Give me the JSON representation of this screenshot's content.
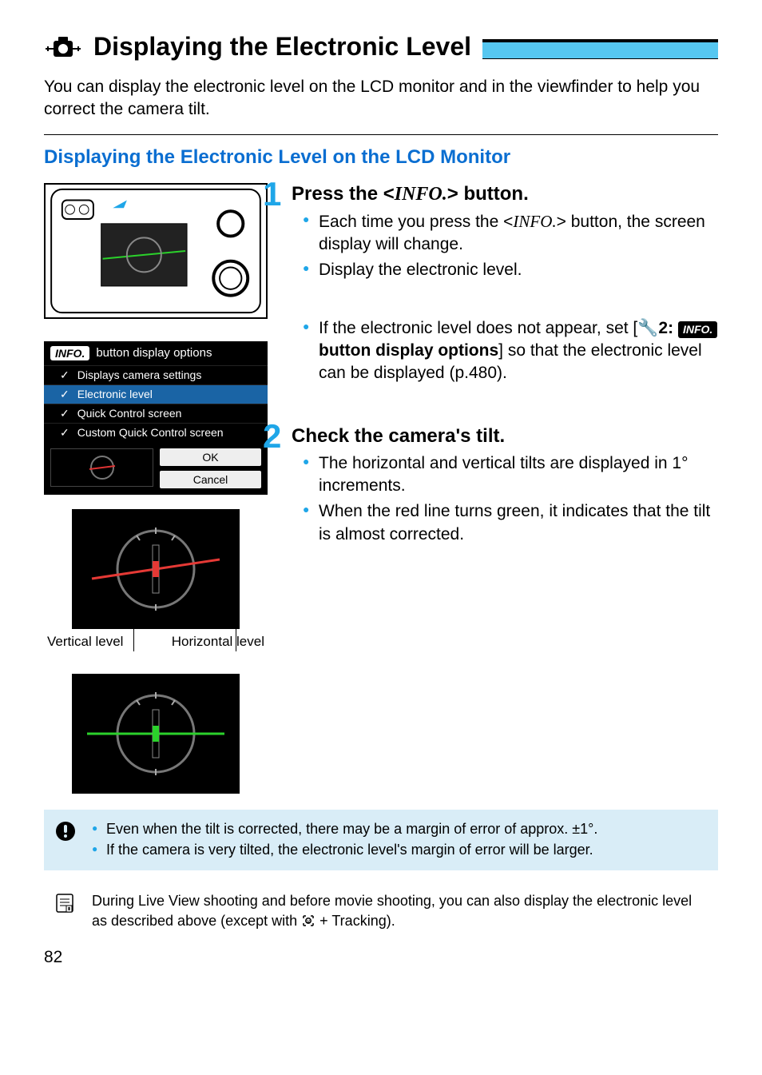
{
  "header": {
    "title": "Displaying the Electronic Level"
  },
  "intro": "You can display the electronic level on the LCD monitor and in the viewfinder to help you correct the camera tilt.",
  "section": {
    "title": "Displaying the Electronic Level on the LCD Monitor"
  },
  "menu": {
    "info_label": "INFO.",
    "head": "button display options",
    "items": [
      "Displays camera settings",
      "Electronic level",
      "Quick Control screen",
      "Custom Quick Control screen"
    ],
    "ok": "OK",
    "cancel": "Cancel"
  },
  "step1": {
    "num": "1",
    "title_pre": "Press the <",
    "title_info": "INFO.",
    "title_post": "> button.",
    "b1_pre": "Each time you press the <",
    "b1_info": "INFO.",
    "b1_post": "> button, the screen display will change.",
    "b2": "Display the electronic level.",
    "b3_pre": "If the electronic level does not appear, set [",
    "b3_wrench": "2:",
    "b3_info": "INFO.",
    "b3_bold": " button display options",
    "b3_post": "] so that the electronic level can be displayed (p.480)."
  },
  "step2": {
    "num": "2",
    "title": "Check the camera's tilt.",
    "b1": "The horizontal and vertical tilts are displayed in 1° increments.",
    "b2": "When the red line turns green, it indicates that the tilt is almost corrected."
  },
  "labels": {
    "vertical": "Vertical level",
    "horizontal": "Horizontal level"
  },
  "note1": {
    "b1": "Even when the tilt is corrected, there may be a margin of error of approx. ±1°.",
    "b2": "If the camera is very tilted, the electronic level's margin of error will be larger."
  },
  "note2": {
    "text_pre": "During Live View shooting and before movie shooting, you can also display the electronic level as described above (except with ",
    "text_post": "+ Tracking)."
  },
  "page_number": "82"
}
